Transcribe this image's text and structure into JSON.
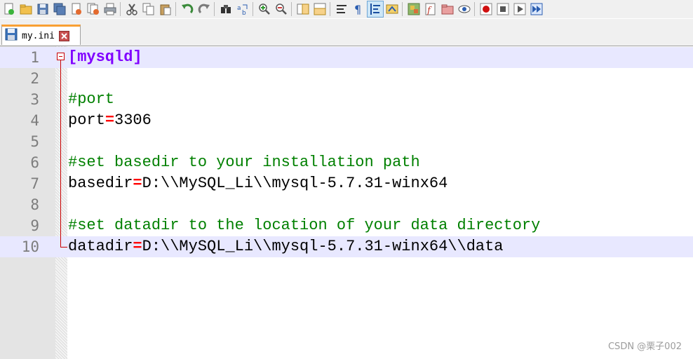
{
  "toolbar": {
    "buttons": [
      "new-file-icon",
      "open-file-icon",
      "save-icon",
      "save-all-icon",
      "close-icon",
      "close-all-icon",
      "print-icon",
      "cut-icon",
      "copy-icon",
      "paste-icon",
      "undo-icon",
      "redo-icon",
      "find-icon",
      "replace-icon",
      "zoom-in-icon",
      "zoom-out-icon",
      "sync-vertical-icon",
      "sync-horizontal-icon",
      "word-wrap-icon",
      "show-all-characters-icon",
      "indent-guide-icon",
      "user-language-icon",
      "document-map-icon",
      "function-list-icon",
      "folder-as-workspace-icon",
      "monitoring-icon",
      "record-macro-icon",
      "stop-recording-icon",
      "playback-macro-icon",
      "run-macro-multiple-icon"
    ]
  },
  "tab": {
    "label": "my.ini"
  },
  "editor": {
    "line_numbers": [
      "1",
      "2",
      "3",
      "4",
      "5",
      "6",
      "7",
      "8",
      "9",
      "10"
    ],
    "lines": [
      {
        "section": "[mysqld]"
      },
      {},
      {
        "comment": "#port"
      },
      {
        "key": "port",
        "eq": "=",
        "value": "3306"
      },
      {},
      {
        "comment": "#set basedir to your installation path"
      },
      {
        "key": "basedir",
        "eq": "=",
        "value": "D:\\\\MySQL_Li\\\\mysql-5.7.31-winx64"
      },
      {},
      {
        "comment": "#set datadir to the location of your data directory"
      },
      {
        "key": "datadir",
        "eq": "=",
        "value": "D:\\\\MySQL_Li\\\\mysql-5.7.31-winx64\\\\data"
      }
    ]
  },
  "watermark": "CSDN @栗子002",
  "colors": {
    "section": "#8000ff",
    "comment": "#008000",
    "operator": "#ff0000",
    "current_line": "#e8e8ff",
    "active_tab_accent": "#f9a034"
  }
}
